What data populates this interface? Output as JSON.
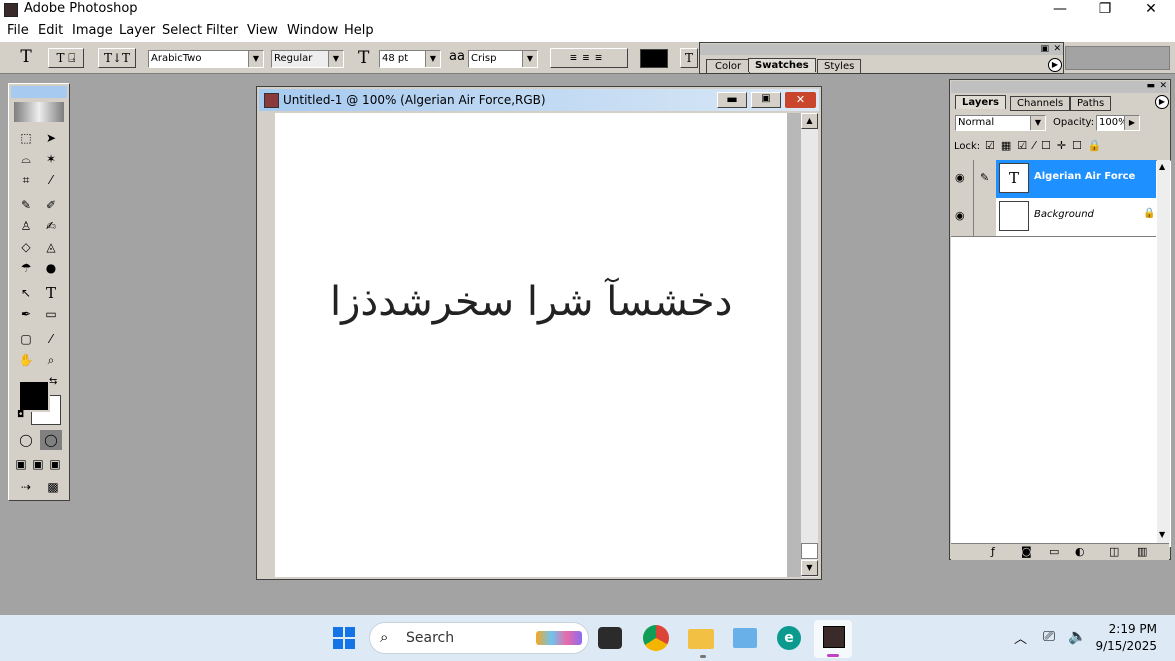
{
  "app": {
    "title": "Adobe Photoshop"
  },
  "window_controls": {
    "minimize": "—",
    "restore": "❐",
    "close": "✕"
  },
  "menu": [
    "File",
    "Edit",
    "Image",
    "Layer",
    "Select",
    "Filter",
    "View",
    "Window",
    "Help"
  ],
  "options": {
    "font_family": "ArabicTwo",
    "font_style": "Regular",
    "font_size": "48 pt",
    "antialias": "Crisp",
    "aa_label": "aa",
    "color": "#000000"
  },
  "swatch_palette": {
    "tabs": [
      "Color",
      "Swatches",
      "Styles"
    ],
    "active": "Swatches"
  },
  "document": {
    "title": "Untitled-1 @ 100% (Algerian Air Force,RGB)",
    "text": "دخشسآ شرا سخرشدذزا"
  },
  "layers_palette": {
    "tabs": [
      "Layers",
      "Channels",
      "Paths"
    ],
    "blend_mode": "Normal",
    "opacity_label": "Opacity:",
    "opacity": "100%",
    "lock_label": "Lock:",
    "layers": [
      {
        "name": "Algerian Air Force",
        "selected": true,
        "thumb": "T"
      },
      {
        "name": "Background",
        "selected": false,
        "thumb": ""
      }
    ]
  },
  "taskbar": {
    "search_placeholder": "Search",
    "time": "2:19 PM",
    "date": "9/15/2025"
  }
}
